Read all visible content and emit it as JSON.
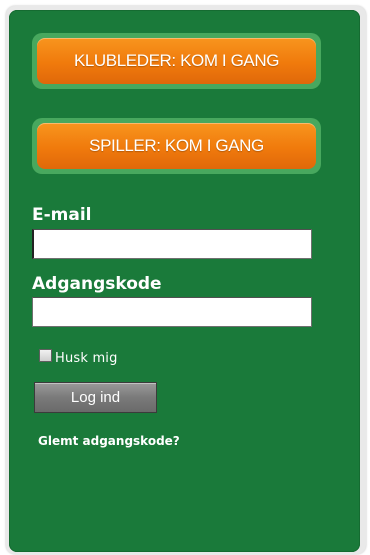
{
  "colors": {
    "panel_green": "#1a7a3a",
    "cta_orange": "#f07a0c",
    "cta_border_green": "#48a85e",
    "login_button_gray": "#7a7a7a"
  },
  "actions": {
    "club_leader_label": "KLUBLEDER: KOM I GANG",
    "player_label": "SPILLER: KOM I GANG"
  },
  "login_form": {
    "email_label": "E-mail",
    "email_value": "",
    "password_label": "Adgangskode",
    "password_value": "",
    "remember_label": "Husk mig",
    "remember_checked": false,
    "submit_label": "Log ind",
    "forgot_link_label": "Glemt adgangskode?"
  }
}
